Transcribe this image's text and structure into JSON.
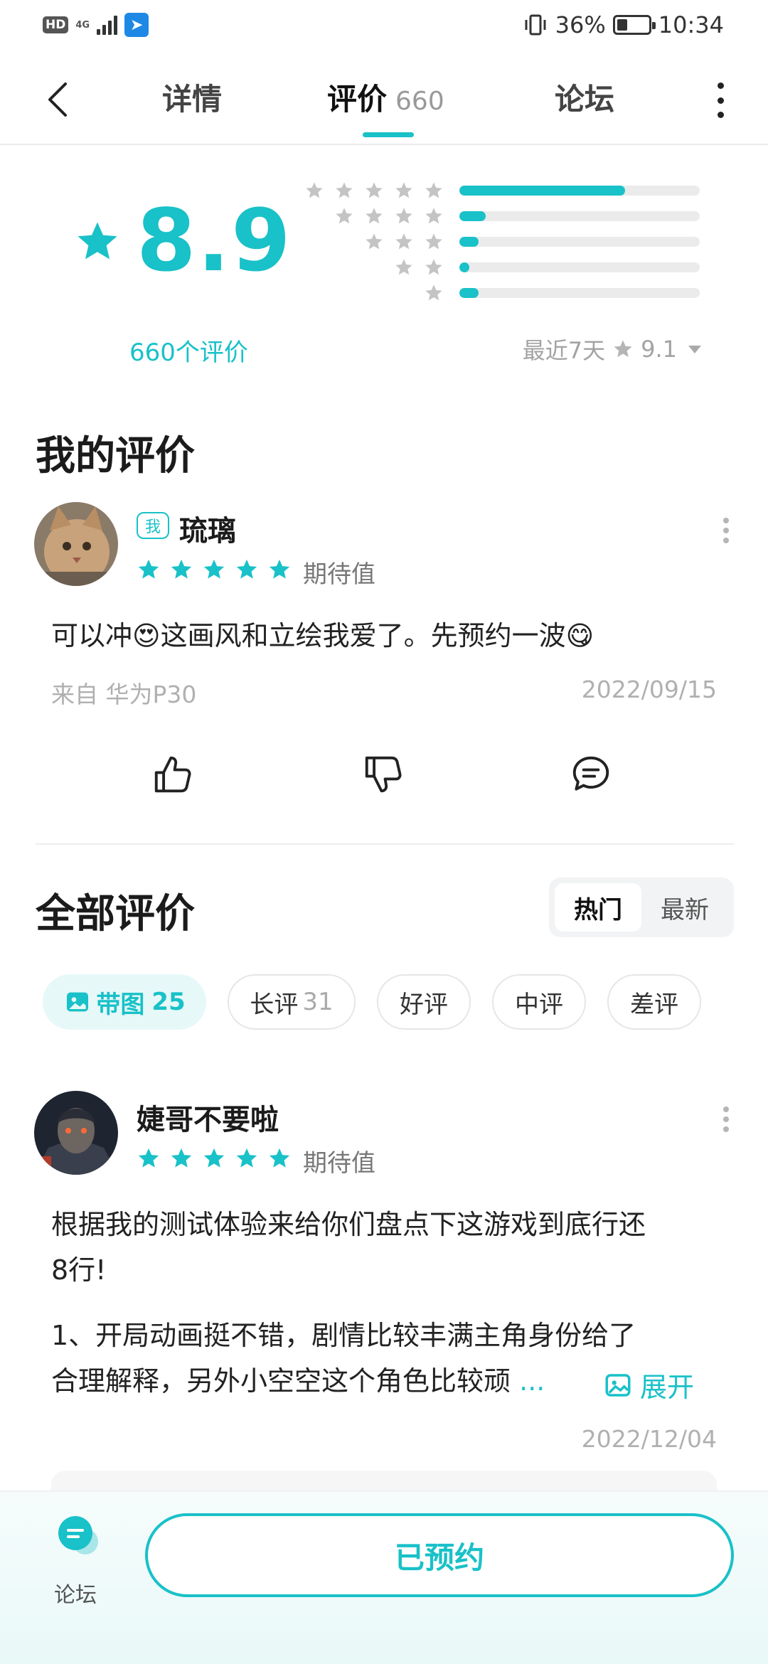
{
  "status_bar": {
    "hd": "HD",
    "network": "4G",
    "battery": "36%",
    "time": "10:34"
  },
  "nav": {
    "tab_detail": "详情",
    "tab_review": "评价",
    "tab_review_count": "660",
    "tab_forum": "论坛"
  },
  "rating": {
    "score": "8.9",
    "count_label": "660个评价",
    "recent_label": "最近7天",
    "recent_score": "9.1",
    "distribution": [
      {
        "stars": 5,
        "fraction": 0.69
      },
      {
        "stars": 4,
        "fraction": 0.11
      },
      {
        "stars": 3,
        "fraction": 0.08
      },
      {
        "stars": 2,
        "fraction": 0.04
      },
      {
        "stars": 1,
        "fraction": 0.08
      }
    ]
  },
  "my_review": {
    "section_title": "我的评价",
    "me_badge": "我",
    "username": "琉璃",
    "stars": 5,
    "tag": "期待值",
    "text": "可以冲😍这画风和立绘我爱了。先预约一波😋",
    "device": "来自 华为P30",
    "date": "2022/09/15"
  },
  "all_reviews": {
    "section_title": "全部评价",
    "sort_hot": "热门",
    "sort_new": "最新",
    "filters": [
      {
        "label": "带图",
        "count": "25"
      },
      {
        "label": "长评",
        "count": "31"
      },
      {
        "label": "好评",
        "count": ""
      },
      {
        "label": "中评",
        "count": ""
      },
      {
        "label": "差评",
        "count": ""
      }
    ],
    "first_review": {
      "username": "婕哥不要啦",
      "stars": 5,
      "tag": "期待值",
      "para1_line1": "根据我的测试体验来给你们盘点下这游戏到底行还",
      "para1_line2": "8行!",
      "para2_line1": "1、开局动画挺不错，剧情比较丰满主角身份给了",
      "para2_line2": "合理解释，另外小空空这个角色比较顽",
      "ellipsis": "...",
      "expand_label": "展开",
      "date": "2022/12/04"
    }
  },
  "bottom": {
    "forum_label": "论坛",
    "reserve_label": "已预约"
  },
  "colors": {
    "accent": "#19c1c8",
    "muted": "#b0b0b0"
  }
}
